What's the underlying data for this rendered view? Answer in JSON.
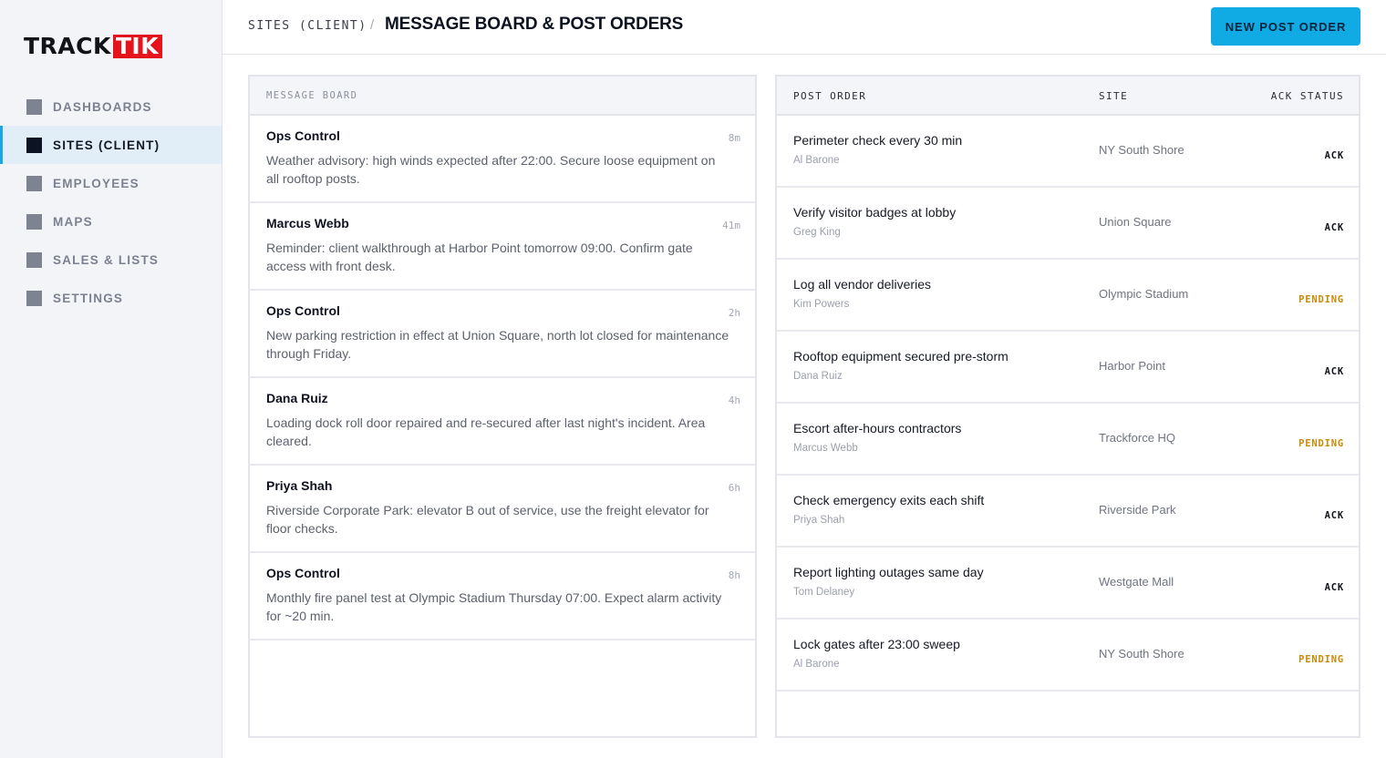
{
  "sidebar": {
    "logo": {
      "track": "TRACK",
      "tik": "TIK"
    },
    "items": [
      {
        "label": "DASHBOARDS",
        "active": false
      },
      {
        "label": "SITES (CLIENT)",
        "active": true
      },
      {
        "label": "EMPLOYEES",
        "active": false
      },
      {
        "label": "MAPS",
        "active": false
      },
      {
        "label": "SALES & LISTS",
        "active": false
      },
      {
        "label": "SETTINGS",
        "active": false
      }
    ]
  },
  "header": {
    "breadcrumb": "SITES (CLIENT)",
    "separator": "/",
    "title": "MESSAGE BOARD & POST ORDERS",
    "new_button": "NEW POST ORDER"
  },
  "message_board": {
    "heading": "MESSAGE BOARD",
    "messages": [
      {
        "author": "Ops Control",
        "time": "8m",
        "text": "Weather advisory: high winds expected after 22:00. Secure loose equipment on all rooftop posts."
      },
      {
        "author": "Marcus Webb",
        "time": "41m",
        "text": "Reminder: client walkthrough at Harbor Point tomorrow 09:00. Confirm gate access with front desk."
      },
      {
        "author": "Ops Control",
        "time": "2h",
        "text": "New parking restriction in effect at Union Square, north lot closed for maintenance through Friday."
      },
      {
        "author": "Dana Ruiz",
        "time": "4h",
        "text": "Loading dock roll door repaired and re-secured after last night's incident. Area cleared."
      },
      {
        "author": "Priya Shah",
        "time": "6h",
        "text": "Riverside Corporate Park: elevator B out of service, use the freight elevator for floor checks."
      },
      {
        "author": "Ops Control",
        "time": "8h",
        "text": "Monthly fire panel test at Olympic Stadium Thursday 07:00. Expect alarm activity for ~20 min."
      }
    ]
  },
  "post_orders": {
    "columns": {
      "order": "POST ORDER",
      "site": "SITE",
      "status": "ACK STATUS"
    },
    "rows": [
      {
        "title": "Perimeter check every 30 min",
        "person": "Al Barone",
        "site": "NY South Shore",
        "status": "ACK"
      },
      {
        "title": "Verify visitor badges at lobby",
        "person": "Greg King",
        "site": "Union Square",
        "status": "ACK"
      },
      {
        "title": "Log all vendor deliveries",
        "person": "Kim Powers",
        "site": "Olympic Stadium",
        "status": "PENDING"
      },
      {
        "title": "Rooftop equipment secured pre-storm",
        "person": "Dana Ruiz",
        "site": "Harbor Point",
        "status": "ACK"
      },
      {
        "title": "Escort after-hours contractors",
        "person": "Marcus Webb",
        "site": "Trackforce HQ",
        "status": "PENDING"
      },
      {
        "title": "Check emergency exits each shift",
        "person": "Priya Shah",
        "site": "Riverside Park",
        "status": "ACK"
      },
      {
        "title": "Report lighting outages same day",
        "person": "Tom Delaney",
        "site": "Westgate Mall",
        "status": "ACK"
      },
      {
        "title": "Lock gates after 23:00 sweep",
        "person": "Al Barone",
        "site": "NY South Shore",
        "status": "PENDING"
      }
    ]
  },
  "colors": {
    "accent": "#10aae5",
    "logo_red": "#e4131c",
    "pending": "#c98a08",
    "active_nav_bg": "#e1eef8"
  }
}
